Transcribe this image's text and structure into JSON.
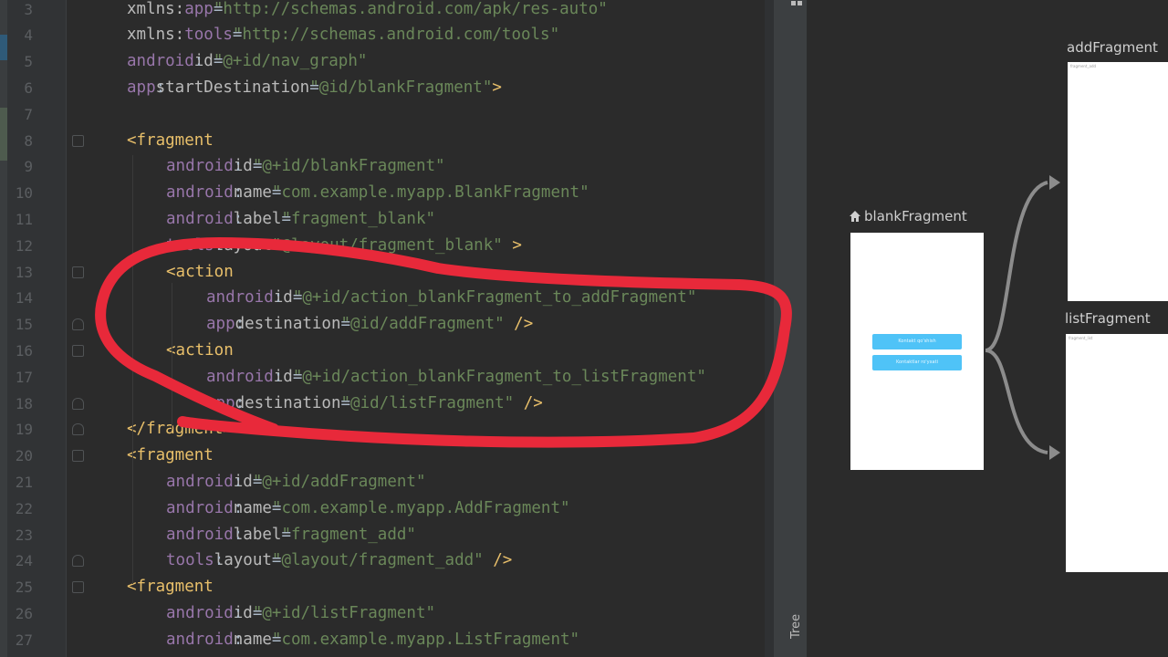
{
  "code_lines": [
    {
      "n": "3",
      "indent": 1,
      "spans": [
        [
          "an",
          "xmlns:"
        ],
        [
          "ns",
          "app"
        ],
        [
          "code",
          "="
        ],
        [
          "av",
          "\"http://schemas.android.com/apk/res-auto\""
        ]
      ]
    },
    {
      "n": "4",
      "indent": 1,
      "spans": [
        [
          "an",
          "xmlns:"
        ],
        [
          "ns",
          "tools"
        ],
        [
          "code",
          "="
        ],
        [
          "av",
          "\"http://schemas.android.com/tools\""
        ]
      ]
    },
    {
      "n": "5",
      "indent": 1,
      "spans": [
        [
          "ns",
          "android"
        ],
        [
          "code",
          ":"
        ],
        [
          "an",
          "id"
        ],
        [
          "code",
          "="
        ],
        [
          "av",
          "\"@+id/nav_graph\""
        ]
      ]
    },
    {
      "n": "6",
      "indent": 1,
      "spans": [
        [
          "ns",
          "app"
        ],
        [
          "code",
          ":"
        ],
        [
          "an",
          "startDestination"
        ],
        [
          "code",
          "="
        ],
        [
          "av",
          "\"@id/blankFragment\""
        ],
        [
          "tag",
          ">"
        ]
      ]
    },
    {
      "n": "7",
      "indent": 1,
      "spans": []
    },
    {
      "n": "8",
      "indent": 1,
      "fold": "down",
      "spans": [
        [
          "tag",
          "<fragment"
        ]
      ]
    },
    {
      "n": "9",
      "indent": 2,
      "spans": [
        [
          "ns",
          "android"
        ],
        [
          "code",
          ":"
        ],
        [
          "an",
          "id"
        ],
        [
          "code",
          "="
        ],
        [
          "av",
          "\"@+id/blankFragment\""
        ]
      ]
    },
    {
      "n": "10",
      "indent": 2,
      "spans": [
        [
          "ns",
          "android"
        ],
        [
          "code",
          ":"
        ],
        [
          "an",
          "name"
        ],
        [
          "code",
          "="
        ],
        [
          "av",
          "\"com.example.myapp.BlankFragment\""
        ]
      ]
    },
    {
      "n": "11",
      "indent": 2,
      "spans": [
        [
          "ns",
          "android"
        ],
        [
          "code",
          ":"
        ],
        [
          "an",
          "label"
        ],
        [
          "code",
          "="
        ],
        [
          "av",
          "\"fragment_blank\""
        ]
      ]
    },
    {
      "n": "12",
      "indent": 2,
      "spans": [
        [
          "ns",
          "tools"
        ],
        [
          "code",
          ":"
        ],
        [
          "an",
          "layout"
        ],
        [
          "code",
          "="
        ],
        [
          "av",
          "\"@layout/fragment_blank\""
        ],
        [
          "tag",
          " >"
        ]
      ]
    },
    {
      "n": "13",
      "indent": 2,
      "fold": "down",
      "spans": [
        [
          "tag",
          "<action"
        ]
      ]
    },
    {
      "n": "14",
      "indent": 3,
      "spans": [
        [
          "ns",
          "android"
        ],
        [
          "code",
          ":"
        ],
        [
          "an",
          "id"
        ],
        [
          "code",
          "="
        ],
        [
          "av",
          "\"@+id/action_blankFragment_to_addFragment\""
        ]
      ]
    },
    {
      "n": "15",
      "indent": 3,
      "fold": "up",
      "spans": [
        [
          "ns",
          "app"
        ],
        [
          "code",
          ":"
        ],
        [
          "an",
          "destination"
        ],
        [
          "code",
          "="
        ],
        [
          "av",
          "\"@id/addFragment\""
        ],
        [
          "tag",
          " />"
        ]
      ]
    },
    {
      "n": "16",
      "indent": 2,
      "fold": "down",
      "spans": [
        [
          "tag",
          "<action"
        ]
      ]
    },
    {
      "n": "17",
      "indent": 3,
      "spans": [
        [
          "ns",
          "android"
        ],
        [
          "code",
          ":"
        ],
        [
          "an",
          "id"
        ],
        [
          "code",
          "="
        ],
        [
          "av",
          "\"@+id/action_blankFragment_to_listFragment\""
        ]
      ]
    },
    {
      "n": "18",
      "indent": 3,
      "fold": "up",
      "spans": [
        [
          "ns",
          "app"
        ],
        [
          "code",
          ":"
        ],
        [
          "an",
          "destination"
        ],
        [
          "code",
          "="
        ],
        [
          "av",
          "\"@id/listFragment\""
        ],
        [
          "tag",
          " />"
        ]
      ]
    },
    {
      "n": "19",
      "indent": 1,
      "fold": "up",
      "spans": [
        [
          "tag",
          "</fragment>"
        ]
      ]
    },
    {
      "n": "20",
      "indent": 1,
      "fold": "down",
      "spans": [
        [
          "tag",
          "<fragment"
        ]
      ]
    },
    {
      "n": "21",
      "indent": 2,
      "spans": [
        [
          "ns",
          "android"
        ],
        [
          "code",
          ":"
        ],
        [
          "an",
          "id"
        ],
        [
          "code",
          "="
        ],
        [
          "av",
          "\"@+id/addFragment\""
        ]
      ]
    },
    {
      "n": "22",
      "indent": 2,
      "spans": [
        [
          "ns",
          "android"
        ],
        [
          "code",
          ":"
        ],
        [
          "an",
          "name"
        ],
        [
          "code",
          "="
        ],
        [
          "av",
          "\"com.example.myapp.AddFragment\""
        ]
      ]
    },
    {
      "n": "23",
      "indent": 2,
      "spans": [
        [
          "ns",
          "android"
        ],
        [
          "code",
          ":"
        ],
        [
          "an",
          "label"
        ],
        [
          "code",
          "="
        ],
        [
          "av",
          "\"fragment_add\""
        ]
      ]
    },
    {
      "n": "24",
      "indent": 2,
      "fold": "up",
      "spans": [
        [
          "ns",
          "tools"
        ],
        [
          "code",
          ":"
        ],
        [
          "an",
          "layout"
        ],
        [
          "code",
          "="
        ],
        [
          "av",
          "\"@layout/fragment_add\""
        ],
        [
          "tag",
          " />"
        ]
      ]
    },
    {
      "n": "25",
      "indent": 1,
      "fold": "down",
      "spans": [
        [
          "tag",
          "<fragment"
        ]
      ]
    },
    {
      "n": "26",
      "indent": 2,
      "spans": [
        [
          "ns",
          "android"
        ],
        [
          "code",
          ":"
        ],
        [
          "an",
          "id"
        ],
        [
          "code",
          "="
        ],
        [
          "av",
          "\"@+id/listFragment\""
        ]
      ]
    },
    {
      "n": "27",
      "indent": 2,
      "spans": [
        [
          "ns",
          "android"
        ],
        [
          "code",
          ":"
        ],
        [
          "an",
          "name"
        ],
        [
          "code",
          "="
        ],
        [
          "av",
          "\"com.example.myapp.ListFragment\""
        ]
      ]
    }
  ],
  "side_panel": {
    "tree_label": "Tree"
  },
  "nav_graph": {
    "start": {
      "label": "blankFragment",
      "icon": "home-icon",
      "buttons": [
        "Kontakt qo'shish",
        "Kontaktlar ro'yxati"
      ]
    },
    "add": {
      "label": "addFragment",
      "preview_text": "fragment_add"
    },
    "list": {
      "label": "listFragment",
      "preview_text": "fragment_list"
    }
  },
  "colors": {
    "annotation": "#e8293a",
    "mini_button": "#4fc3f7",
    "arrow": "#8c8c8c"
  }
}
